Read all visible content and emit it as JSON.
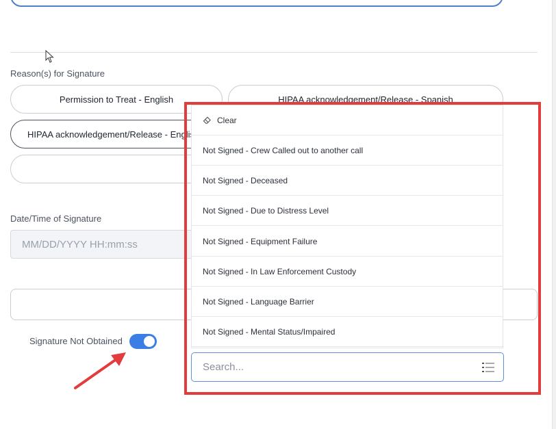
{
  "reasons": {
    "label": "Reason(s) for Signature",
    "pills": [
      "Permission to Treat - English",
      "HIPAA acknowledgement/Release - Spanish",
      "HIPAA acknowledgement/Release - English",
      ""
    ]
  },
  "date": {
    "label": "Date/Time of Signature",
    "placeholder": "MM/DD/YYYY HH:mm:ss"
  },
  "signature_toggle": {
    "label": "Signature Not Obtained",
    "on": true
  },
  "dropdown": {
    "clear_label": "Clear",
    "options": [
      "Not Signed - Crew Called out to another call",
      "Not Signed - Deceased",
      "Not Signed - Due to Distress Level",
      "Not Signed - Equipment Failure",
      "Not Signed - In Law Enforcement Custody",
      "Not Signed - Language Barrier",
      "Not Signed - Mental Status/Impaired"
    ],
    "search_placeholder": "Search..."
  },
  "colors": {
    "accent": "#3a7ee6",
    "highlight": "#e23c3c"
  },
  "icons": [
    "eraser-icon",
    "list-icon",
    "cursor-icon",
    "arrow-annotation"
  ]
}
